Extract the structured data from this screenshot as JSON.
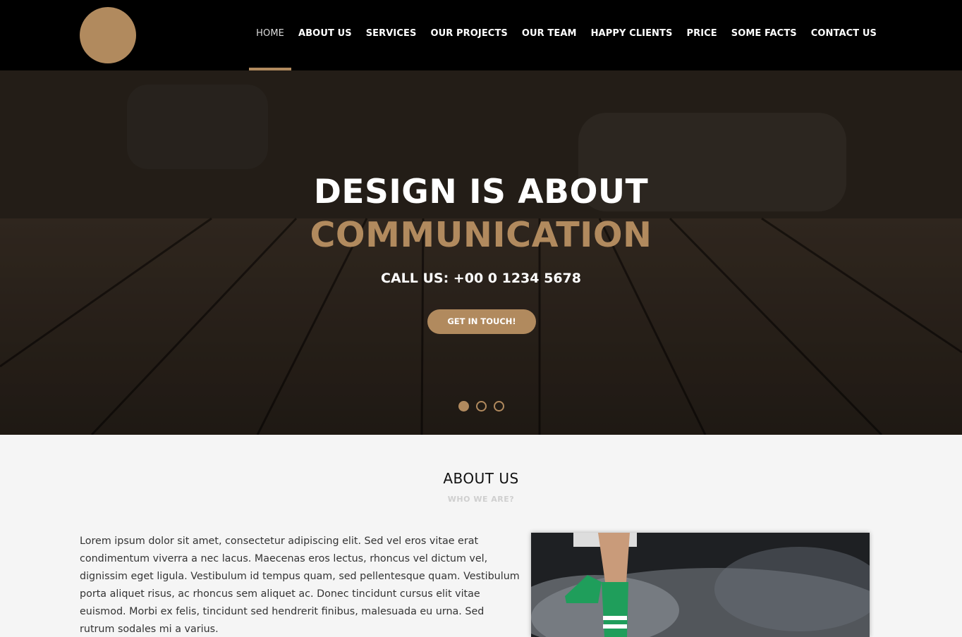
{
  "nav": {
    "items": [
      {
        "label": "HOME",
        "active": true
      },
      {
        "label": "ABOUT US"
      },
      {
        "label": "SERVICES"
      },
      {
        "label": "OUR PROJECTS"
      },
      {
        "label": "OUR TEAM"
      },
      {
        "label": "HAPPY CLIENTS"
      },
      {
        "label": "PRICE"
      },
      {
        "label": "SOME FACTS"
      },
      {
        "label": "CONTACT US"
      }
    ]
  },
  "hero": {
    "line1": "DESIGN IS ABOUT",
    "line2": "COMMUNICATION",
    "phone": "CALL US: +00 0 1234 5678",
    "button_label": "GET IN TOUCH!",
    "slides_count": 3,
    "active_slide": 1
  },
  "about": {
    "title": "ABOUT US",
    "subtitle": "WHO WE ARE?",
    "text": "Lorem ipsum dolor sit amet, consectetur adipiscing elit. Sed vel eros vitae erat condimentum viverra a nec lacus. Maecenas eros lectus, rhoncus vel dictum vel, dignissim eget ligula. Vestibulum id tempus quam, sed pellentesque quam. Vestibulum porta aliquet risus, ac rhoncus sem aliquet ac. Donec tincidunt cursus elit vitae euismod. Morbi ex felis, tincidunt sed hendrerit finibus, malesuada eu urna. Sed rutrum sodales mi a varius."
  },
  "colors": {
    "accent": "#b18a5e",
    "header_bg": "#000000",
    "section_bg": "#f5f5f5"
  }
}
